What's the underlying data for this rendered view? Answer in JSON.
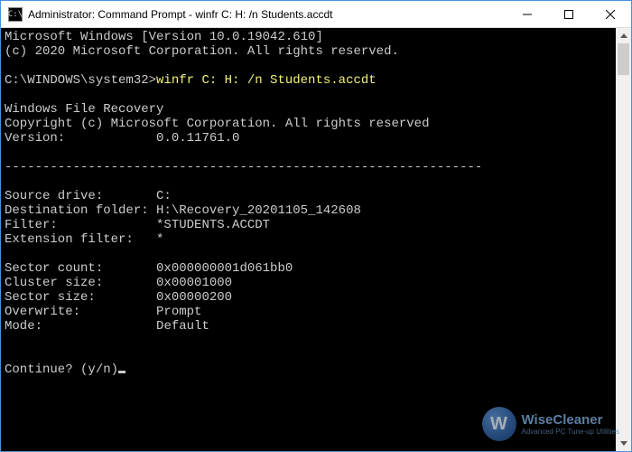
{
  "titlebar": {
    "icon_glyph": "C:\\",
    "title": "Administrator: Command Prompt - winfr  C: H: /n Students.accdt"
  },
  "terminal": {
    "line_os": "Microsoft Windows [Version 10.0.19042.610]",
    "line_copyright_os": "(c) 2020 Microsoft Corporation. All rights reserved.",
    "prompt_path": "C:\\WINDOWS\\system32>",
    "command": "winfr C: H: /n Students.accdt",
    "app_name": "Windows File Recovery",
    "app_copyright": "Copyright (c) Microsoft Corporation. All rights reserved",
    "version_label": "Version:",
    "version_value": "0.0.11761.0",
    "divider": "---------------------------------------------------------------",
    "fields": {
      "source_drive": {
        "label": "Source drive:",
        "value": "C:"
      },
      "destination_folder": {
        "label": "Destination folder:",
        "value": "H:\\Recovery_20201105_142608"
      },
      "filter": {
        "label": "Filter:",
        "value": "*STUDENTS.ACCDT"
      },
      "extension_filter": {
        "label": "Extension filter:",
        "value": "*"
      },
      "sector_count": {
        "label": "Sector count:",
        "value": "0x000000001d061bb0"
      },
      "cluster_size": {
        "label": "Cluster size:",
        "value": "0x00001000"
      },
      "sector_size": {
        "label": "Sector size:",
        "value": "0x00000200"
      },
      "overwrite": {
        "label": "Overwrite:",
        "value": "Prompt"
      },
      "mode": {
        "label": "Mode:",
        "value": "Default"
      }
    },
    "continue_prompt": "Continue? (y/n)"
  },
  "watermark": {
    "letter": "W",
    "name": "WiseCleaner",
    "tag": "Advanced PC Tune-up Utilities"
  }
}
